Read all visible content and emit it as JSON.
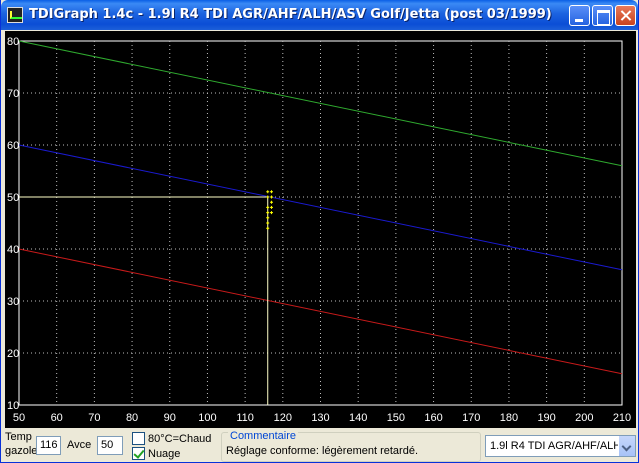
{
  "window": {
    "title": "TDIGraph 1.4c - 1.9l R4 TDI AGR/AHF/ALH/ASV Golf/Jetta (post 03/1999)"
  },
  "chart_data": {
    "type": "line",
    "xlim": [
      50,
      210
    ],
    "ylim": [
      10,
      80
    ],
    "x_ticks": [
      50,
      60,
      70,
      80,
      90,
      100,
      110,
      120,
      130,
      140,
      150,
      160,
      170,
      180,
      190,
      200,
      210
    ],
    "y_ticks": [
      10,
      20,
      30,
      40,
      50,
      60,
      70,
      80
    ],
    "grid": true,
    "series": [
      {
        "color": "#2faa2f",
        "x": [
          50,
          210
        ],
        "y": [
          80,
          56
        ]
      },
      {
        "color": "#1a1ad0",
        "x": [
          50,
          210
        ],
        "y": [
          60,
          36
        ]
      },
      {
        "color": "#c81a1a",
        "x": [
          50,
          210
        ],
        "y": [
          40,
          16
        ]
      }
    ],
    "crosshair": {
      "x": 116,
      "y": 50,
      "color": "#ffffc8"
    },
    "points": [
      {
        "x": 117,
        "y": 51
      },
      {
        "x": 116,
        "y": 51
      },
      {
        "x": 116,
        "y": 50
      },
      {
        "x": 117,
        "y": 50
      },
      {
        "x": 117,
        "y": 49
      },
      {
        "x": 116,
        "y": 48
      },
      {
        "x": 117,
        "y": 48
      },
      {
        "x": 116,
        "y": 47
      },
      {
        "x": 117,
        "y": 47
      },
      {
        "x": 116,
        "y": 46
      },
      {
        "x": 116,
        "y": 45
      },
      {
        "x": 116,
        "y": 44
      }
    ]
  },
  "controls": {
    "temp_label_1": "Temp",
    "temp_label_2": "gazole",
    "temp_value": "116",
    "avce_label": "Avce",
    "avce_value": "50",
    "chaud_label": "80°C=Chaud",
    "chaud_checked": false,
    "nuage_label": "Nuage",
    "nuage_checked": true,
    "commentaire_title": "Commentaire",
    "commentaire_text": "Réglage conforme: légèrement retardé.",
    "engine_select": "1.9l R4 TDI AGR/AHF/ALH"
  }
}
